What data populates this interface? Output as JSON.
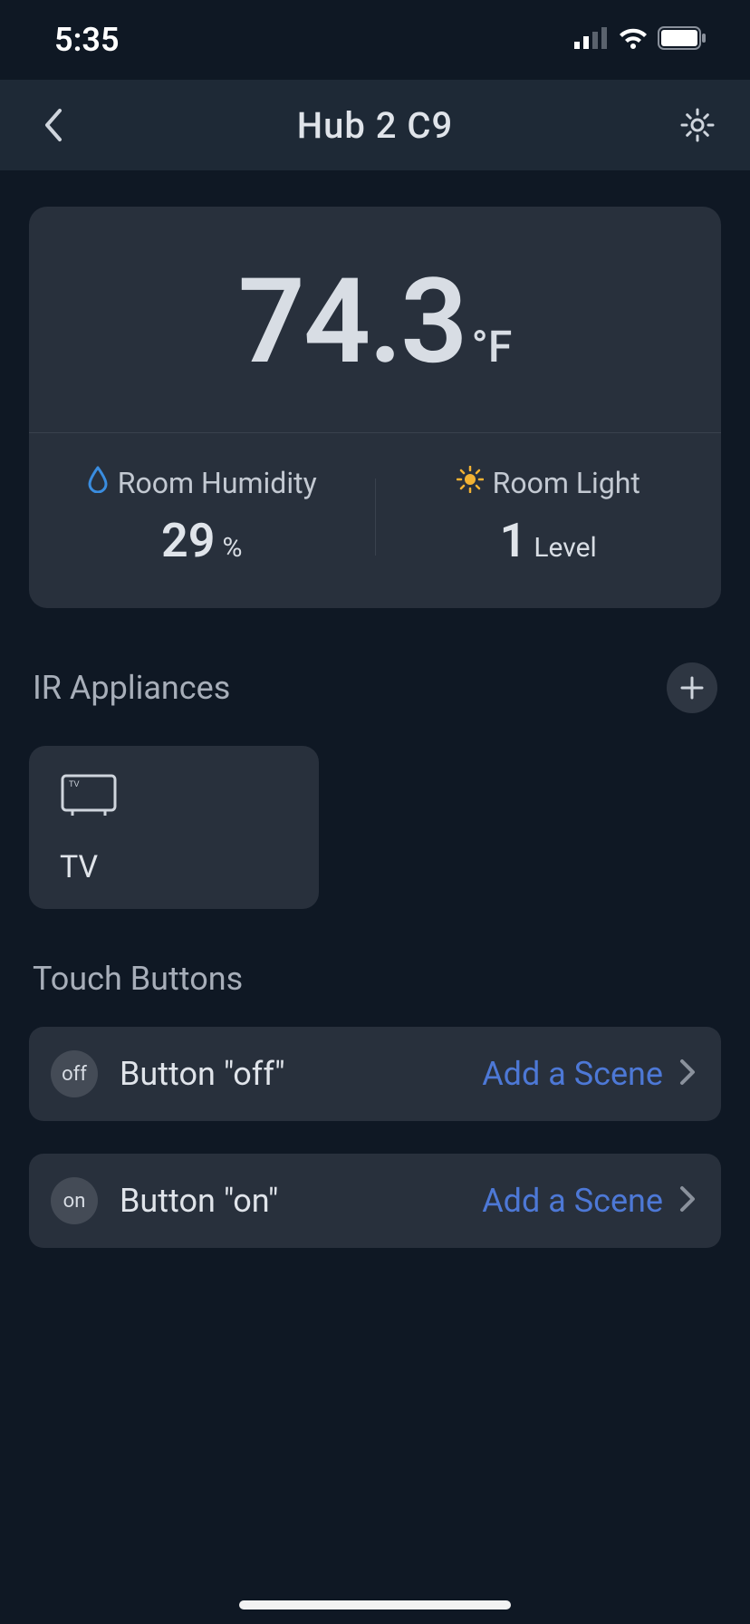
{
  "status": {
    "time": "5:35"
  },
  "nav": {
    "title": "Hub 2 C9"
  },
  "sensor": {
    "temperature_value": "74.3",
    "temperature_unit": "°F",
    "humidity_label": "Room Humidity",
    "humidity_value": "29",
    "humidity_unit": "%",
    "light_label": "Room Light",
    "light_value": "1",
    "light_unit": "Level"
  },
  "sections": {
    "ir_title": "IR Appliances",
    "touch_title": "Touch Buttons"
  },
  "appliances": [
    {
      "name": "TV",
      "icon": "tv-icon"
    }
  ],
  "touch_buttons": [
    {
      "badge": "off",
      "label": "Button \"off\"",
      "action": "Add a Scene"
    },
    {
      "badge": "on",
      "label": "Button \"on\"",
      "action": "Add a Scene"
    }
  ]
}
